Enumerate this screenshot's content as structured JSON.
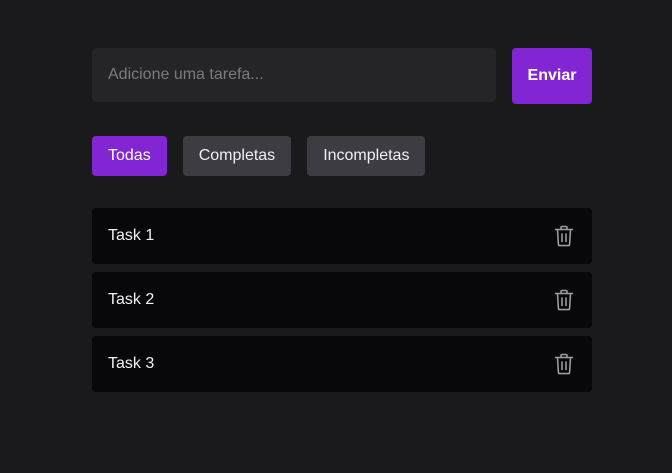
{
  "form": {
    "input_placeholder": "Adicione uma tarefa...",
    "input_value": "",
    "submit_label": "Enviar"
  },
  "filters": [
    {
      "label": "Todas",
      "active": true
    },
    {
      "label": "Completas",
      "active": false
    },
    {
      "label": "Incompletas",
      "active": false
    }
  ],
  "tasks": [
    {
      "label": "Task 1",
      "icon": "trash-icon"
    },
    {
      "label": "Task 2",
      "icon": "trash-icon"
    },
    {
      "label": "Task 3",
      "icon": "trash-icon"
    }
  ],
  "colors": {
    "background": "#1a1a1c",
    "accent": "#8226d4",
    "input_bg": "#252527",
    "filter_bg": "#3c3c42",
    "task_bg": "#08080a",
    "icon": "#9b9ba0"
  }
}
